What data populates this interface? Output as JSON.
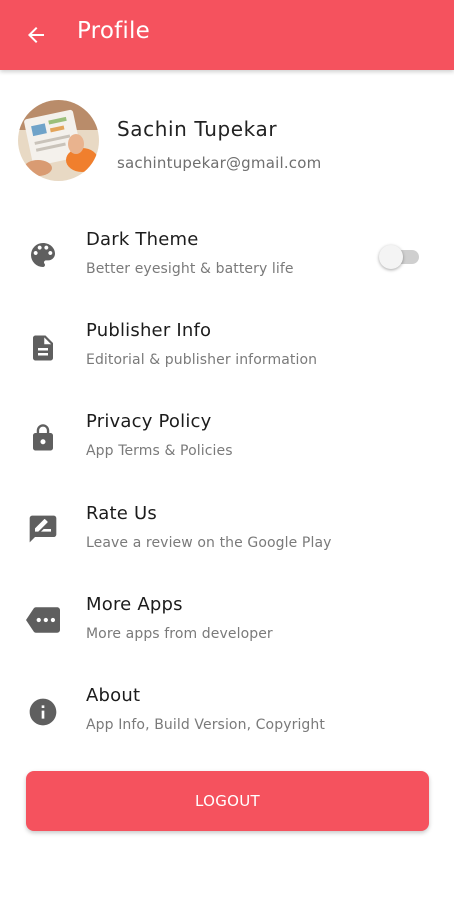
{
  "colors": {
    "accent": "#f5525e",
    "icon": "#5f5f5f",
    "title_text": "#1c1c1c",
    "subtitle_text": "#7a7a7a"
  },
  "appbar": {
    "back_icon": "arrow-left-icon",
    "title": "Profile"
  },
  "profile": {
    "name": "Sachin Tupekar",
    "email": "sachintupekar@gmail.com"
  },
  "menu": {
    "dark_theme": {
      "icon": "palette-icon",
      "title": "Dark Theme",
      "subtitle": "Better eyesight & battery life",
      "toggle_on": false
    },
    "publisher_info": {
      "icon": "document-icon",
      "title": "Publisher Info",
      "subtitle": "Editorial & publisher information"
    },
    "privacy_policy": {
      "icon": "lock-icon",
      "title": "Privacy Policy",
      "subtitle": "App Terms & Policies"
    },
    "rate_us": {
      "icon": "rate-review-icon",
      "title": "Rate Us",
      "subtitle": "Leave a review on the Google Play"
    },
    "more_apps": {
      "icon": "more-tag-icon",
      "title": "More Apps",
      "subtitle": "More apps from developer"
    },
    "about": {
      "icon": "info-icon",
      "title": "About",
      "subtitle": "App Info, Build Version, Copyright"
    }
  },
  "logout_label": "LOGOUT"
}
